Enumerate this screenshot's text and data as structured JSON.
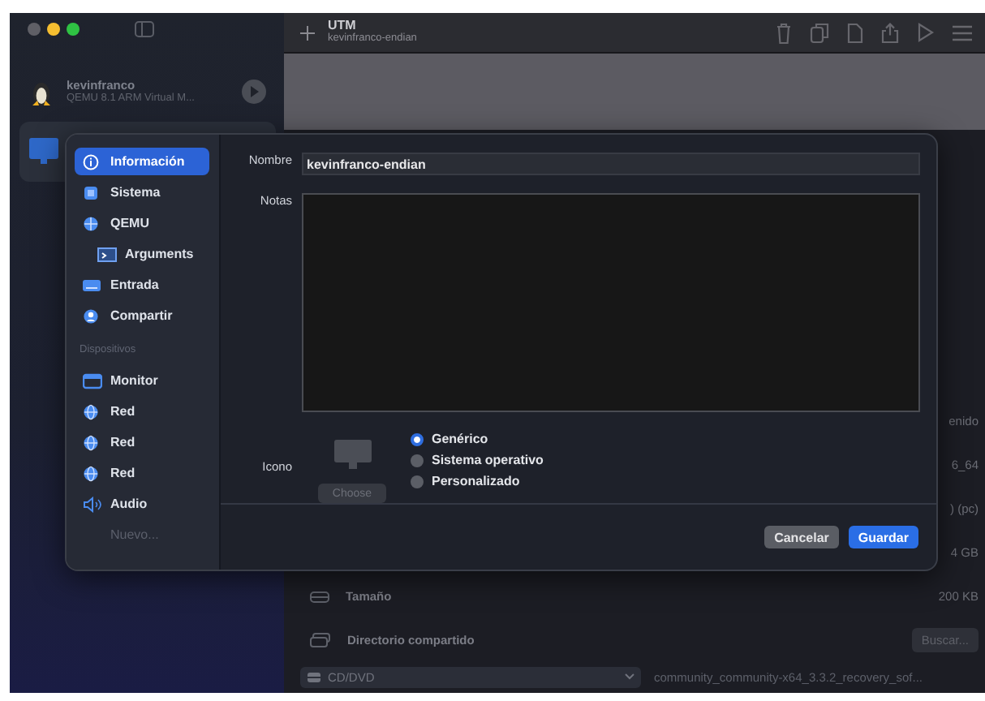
{
  "toolbar": {
    "title": "UTM",
    "subtitle": "kevinfranco-endian"
  },
  "vm_list": [
    {
      "name": "kevinfranco",
      "description": "QEMU 8.1 ARM Virtual M...",
      "kind": "linux",
      "selected": false
    },
    {
      "kind": "generic",
      "selected": true
    }
  ],
  "details": {
    "rows": [
      {
        "value": "enido"
      },
      {
        "value": "6_64"
      },
      {
        "value": ") (pc)"
      },
      {
        "value": "4 GB"
      },
      {
        "kind": "size",
        "label": "Tamaño",
        "value": "200 KB"
      },
      {
        "kind": "shared",
        "label": "Directorio compartido",
        "button": "Buscar..."
      }
    ],
    "drive": {
      "type": "CD/DVD",
      "path": "community_community-x64_3.3.2_recovery_sof..."
    }
  },
  "dialog": {
    "nav": [
      {
        "kind": "info",
        "label": "Información",
        "selected": true
      },
      {
        "kind": "system",
        "label": "Sistema",
        "selected": false
      },
      {
        "kind": "qemu",
        "label": "QEMU",
        "selected": false,
        "children": [
          {
            "kind": "args",
            "label": "Arguments",
            "selected": false
          }
        ]
      },
      {
        "kind": "input",
        "label": "Entrada",
        "selected": false
      },
      {
        "kind": "share",
        "label": "Compartir",
        "selected": false
      },
      {
        "kind": "header",
        "label": "Dispositivos"
      },
      {
        "kind": "display",
        "label": "Monitor",
        "selected": false
      },
      {
        "kind": "network",
        "label": "Red",
        "selected": false
      },
      {
        "kind": "network",
        "label": "Red",
        "selected": false
      },
      {
        "kind": "network",
        "label": "Red",
        "selected": false
      },
      {
        "kind": "audio",
        "label": "Audio",
        "selected": false
      },
      {
        "kind": "new",
        "label": "Nuevo..."
      }
    ],
    "name_label": "Nombre",
    "name_value": "kevinfranco-endian",
    "notes_label": "Notas",
    "icon_label": "Icono",
    "choose_button": {
      "label": "Choose",
      "disabled": true
    },
    "icon_options": [
      {
        "label": "Genérico",
        "selected": true
      },
      {
        "label": "Sistema operativo",
        "selected": false
      },
      {
        "label": "Personalizado",
        "selected": false
      }
    ],
    "buttons": [
      {
        "label": "Cancelar",
        "kind": "secondary"
      },
      {
        "label": "Guardar",
        "kind": "primary"
      }
    ]
  }
}
